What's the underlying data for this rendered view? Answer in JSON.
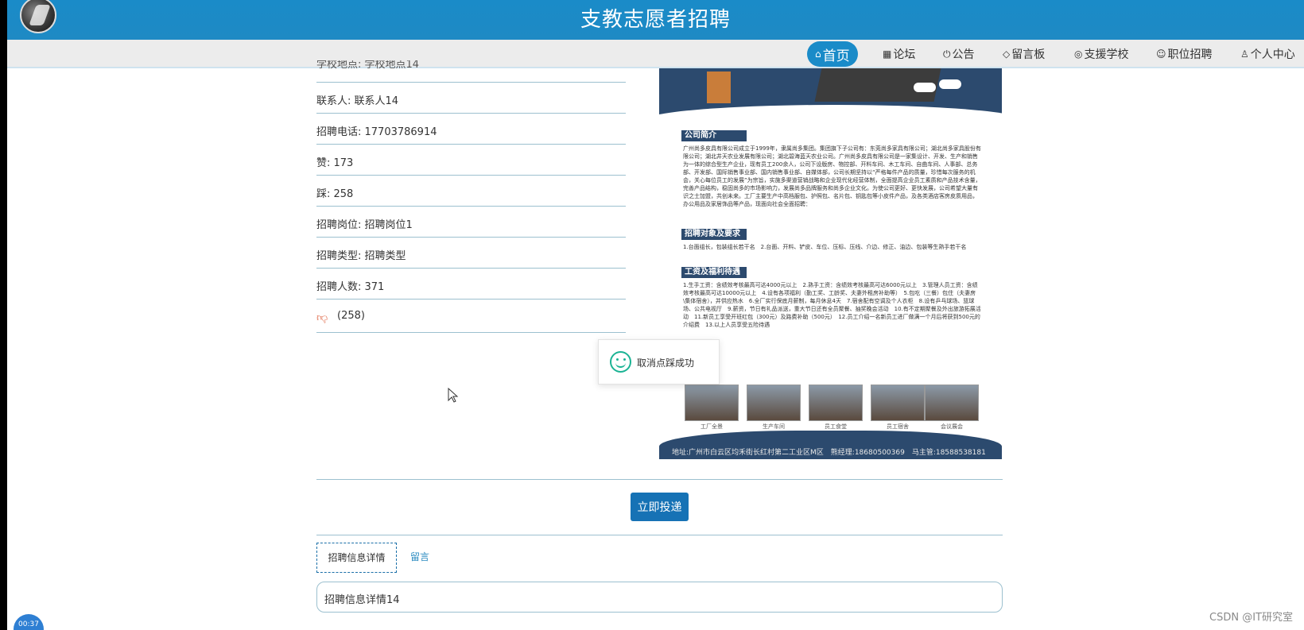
{
  "header": {
    "site_title": "支教志愿者招聘"
  },
  "nav": {
    "items": [
      {
        "icon": "home-icon",
        "label": "首页",
        "active": true
      },
      {
        "icon": "forum-icon",
        "label": "论坛"
      },
      {
        "icon": "power-icon",
        "label": "公告"
      },
      {
        "icon": "tag-icon",
        "label": "留言板"
      },
      {
        "icon": "globe-icon",
        "label": "支援学校"
      },
      {
        "icon": "face-icon",
        "label": "职位招聘"
      },
      {
        "icon": "user-icon",
        "label": "个人中心"
      }
    ]
  },
  "details": {
    "partial": "学校地点: 学校地点14",
    "contact": "联系人: 联系人14",
    "phone": "招聘电话: 17703786914",
    "likes": "赞: 173",
    "dislikes": "踩: 258",
    "position": "招聘岗位: 招聘岗位1",
    "type": "招聘类型: 招聘类型",
    "count": "招聘人数: 371",
    "dislike_count": "(258)"
  },
  "poster": {
    "section1": "公司简介",
    "section2": "招聘对象及要求",
    "section3": "工资及福利待遇",
    "intro_text": "广州尚多皮具有限公司成立于1999年，隶属尚多集团。集团旗下子公司有：东莞尚多家具有限公司；湖北尚多家具股份有限公司；湖北井天农业发展有限公司；湖北碧海蓝天农业公司。广州尚多皮具有限公司是一家集设计、开发、生产和销售为一体的综合型生产企业，现有员工200余人，公司下设版房、物控部、开料车间、木工车间、自曲车间、人事部、总务部、开发部、国际销售事业部、国内销售事业部、自媒体部，公司长期坚持以“严格每件产品的质量，珍惜每次服务的机会，关心每位员工的发展”为宗旨，实施多渠道营销战略和企业现代化经营体制，全面提高企业员工素质和产品技术含量，完善产品结构，稳固尚多的市场影响力，发展尚多品牌服务和尚多企业文化。为使公司更好、更快发展，公司希望大量有识之士加盟，共创未来。工厂主要生产中高档服包、护照包、名片包、钥匙包等小皮件产品，及各类酒店客房皮质用品，办公用品及家居饰品等产品，现面向社会全面招聘：",
    "req_text": "1.台面组长，包装组长若干名　2.台面、开料、铲皮、车位、压标、压线、介边、修正、油边、包装等生熟手若干名",
    "wage_text": "1.生手工资：含绩效考核最高可达4000元以上　2.熟手工资：含绩效考核最高可达6000元以上　3.管理人员工资：含绩效考核最高可达10000元以上　4.设有各项福利（勤工奖、工龄奖、夫妻外租房补助等）　5.包吃（三餐）包住（夫妻房\\集体宿舍），并供应热水　6.全厂实行保底月薪制，每月休息4天　7.宿舍配有空调及个人衣柜　8.设有乒乓球场、篮球场、公共电视厅　9.薪资，节日有礼品派送，重大节日还有全员聚餐、抽奖晚会活动　10.有不定期聚餐及外出旅游拓展活动　11.新员工享受开班红包（300元）及路费补助（500元）　12.员工介绍一名新员工进厂做满一个月后将获到500元的介绍费　13.以上人员享受五险待遇",
    "photos": [
      "工厂全景",
      "生产车间",
      "员工食堂",
      "员工宿舍",
      "会议展会"
    ],
    "address": "地址:广州市白云区均禾街长红村第二工业区M区　熊经理:18680500369　马主管:18588538181"
  },
  "toast": {
    "message": "取消点踩成功"
  },
  "actions": {
    "apply_label": "立即投递"
  },
  "tabs": {
    "detail_label": "招聘信息详情",
    "comment_label": "留言"
  },
  "content": {
    "detail_text": "招聘信息详情14"
  },
  "overlay": {
    "timer": "00:37",
    "watermark": "CSDN @IT研究室"
  },
  "colors": {
    "primary": "#1a8bc8",
    "button": "#1672b5",
    "success": "#1bb394",
    "dislike": "#e06b4b"
  }
}
